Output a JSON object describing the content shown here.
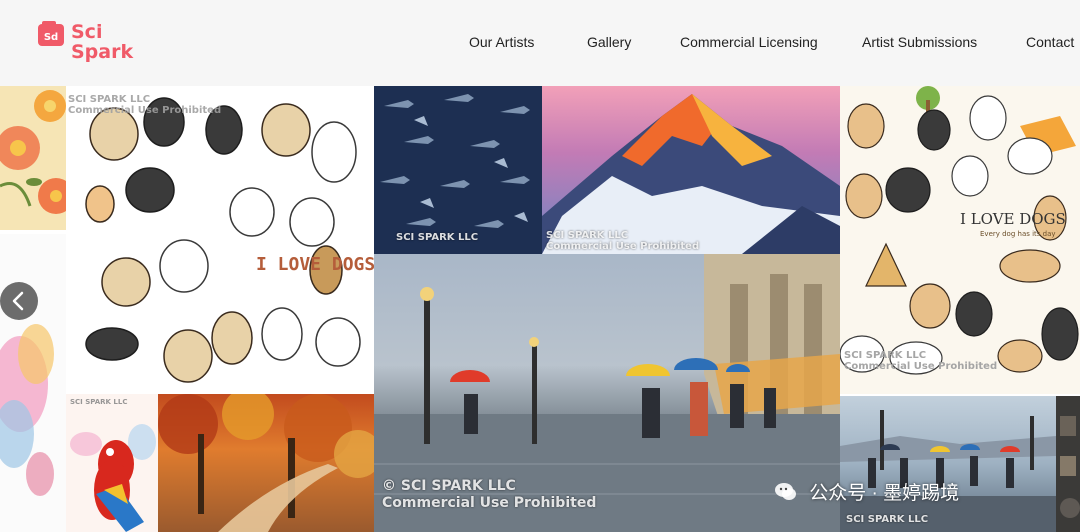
{
  "brand": {
    "name_line1": "Sci",
    "name_line2": "Spark",
    "mark_text": "Sd",
    "color": "#f05a68"
  },
  "nav": {
    "items": [
      {
        "label": "Our Artists"
      },
      {
        "label": "Gallery"
      },
      {
        "label": "Commercial Licensing"
      },
      {
        "label": "Artist Submissions"
      },
      {
        "label": "Contact"
      }
    ]
  },
  "gallery": {
    "watermark": {
      "line1": "SCI SPARK LLC",
      "line2": "Commercial Use Prohibited",
      "line1_alt": "© SCI SPARK LLC"
    },
    "tiles": [
      {
        "name": "floral-pattern",
        "icon": "flower-icon",
        "colors": [
          "#f4a73f",
          "#f07a4a"
        ]
      },
      {
        "name": "floral-watercolor",
        "icon": "watercolor-icon"
      },
      {
        "name": "dogs-sticker-sheet",
        "text": "I LOVE DOGS"
      },
      {
        "name": "shark-pattern",
        "icon": "shark-icon",
        "colors": [
          "#1d2f52",
          "#7d93b0"
        ]
      },
      {
        "name": "mountain-sunset",
        "icon": "mountain-icon"
      },
      {
        "name": "paris-rain-street",
        "icon": "umbrella-icon"
      },
      {
        "name": "parrot-watercolor",
        "icon": "parrot-icon"
      },
      {
        "name": "autumn-forest-path",
        "icon": "tree-icon"
      },
      {
        "name": "dogs-park-sheet",
        "text": "I LOVE DOGS",
        "subtext": "Every dog has its day"
      },
      {
        "name": "rainy-riverside",
        "icon": "umbrella-icon"
      }
    ]
  },
  "carousel": {
    "prev_icon": "chevron-left-icon"
  },
  "overlay": {
    "wechat_text": "公众号 · 墨婷踢境",
    "icon": "wechat-icon"
  }
}
